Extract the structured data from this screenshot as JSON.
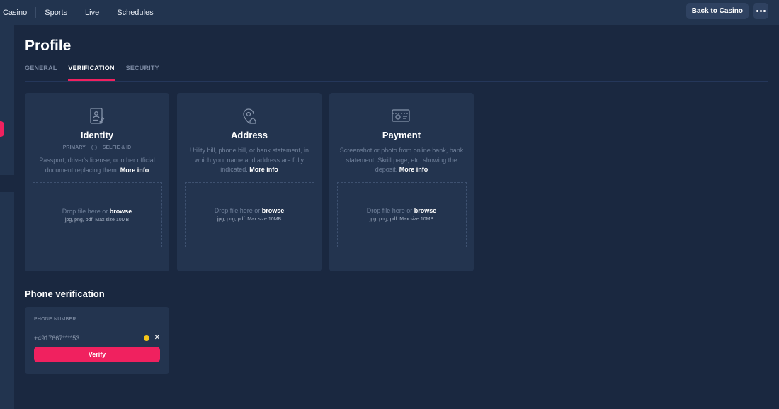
{
  "topnav": {
    "items": [
      "Casino",
      "Sports",
      "Live",
      "Schedules"
    ]
  },
  "header": {
    "back_label": "Back to Casino",
    "more_icon": "more-dots-icon"
  },
  "page": {
    "title": "Profile"
  },
  "tabs": [
    {
      "label": "GENERAL",
      "active": false
    },
    {
      "label": "VERIFICATION",
      "active": true
    },
    {
      "label": "SECURITY",
      "active": false
    }
  ],
  "cards": [
    {
      "icon": "id-document-icon",
      "title": "Identity",
      "tag_primary": "PRIMARY",
      "tag_secondary": "SELFIE & ID",
      "desc": "Passport, driver's license, or other official document replacing them.",
      "more": "More info",
      "drop_text": "Drop file here or",
      "browse": "browse",
      "formats": "jpg, png, pdf. Max size 10MB"
    },
    {
      "icon": "location-home-icon",
      "title": "Address",
      "desc": "Utility bill, phone bill, or bank statement, in which your name and address are fully indicated.",
      "more": "More info",
      "drop_text": "Drop file here or",
      "browse": "browse",
      "formats": "jpg, png, pdf. Max size 10MB"
    },
    {
      "icon": "payment-card-icon",
      "title": "Payment",
      "desc": "Screenshot or photo from online bank, bank statement, Skrill page, etc. showing the deposit.",
      "more": "More info",
      "drop_text": "Drop file here or",
      "browse": "browse",
      "formats": "jpg, png, pdf. Max size 10MB"
    }
  ],
  "phone": {
    "section_title": "Phone verification",
    "label": "PHONE NUMBER",
    "value": "+4917667****53",
    "status_color": "#f5c518",
    "verify_label": "Verify"
  },
  "colors": {
    "accent": "#f0215f",
    "bg": "#1a2840",
    "card": "#23344f"
  }
}
